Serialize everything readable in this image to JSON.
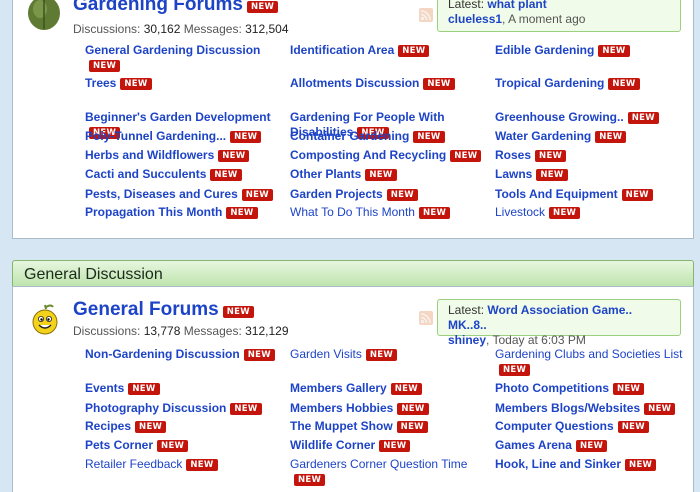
{
  "top_section": {
    "forum_title": "Gardening Forums",
    "new_badge": "NEW",
    "discussions_label": "Discussions:",
    "discussions_count": "30,162",
    "messages_label": "Messages:",
    "messages_count": "312,504",
    "latest_label": "Latest:",
    "latest_thread": "what plant",
    "latest_user": "clueless1",
    "latest_time": "A moment ago",
    "subforums": [
      {
        "label": "General Gardening Discussion",
        "bold": true
      },
      {
        "label": "Identification Area",
        "bold": true
      },
      {
        "label": "Edible Gardening",
        "bold": true
      },
      {
        "label": "Trees",
        "bold": true
      },
      {
        "label": "Allotments Discussion",
        "bold": true
      },
      {
        "label": "Tropical Gardening",
        "bold": true
      },
      {
        "label": "Beginner's Garden Development",
        "bold": true
      },
      {
        "label": "Gardening For People With Disabilities",
        "bold": true
      },
      {
        "label": "Greenhouse Growing..",
        "bold": true
      },
      {
        "label": "Poly-Tunnel Gardening...",
        "bold": true
      },
      {
        "label": "Container Gardening",
        "bold": true
      },
      {
        "label": "Water Gardening",
        "bold": true
      },
      {
        "label": "Herbs and Wildflowers",
        "bold": true
      },
      {
        "label": "Composting And Recycling",
        "bold": true
      },
      {
        "label": "Roses",
        "bold": true
      },
      {
        "label": "Cacti and Succulents",
        "bold": true
      },
      {
        "label": "Other Plants",
        "bold": true
      },
      {
        "label": "Lawns",
        "bold": true
      },
      {
        "label": "Pests, Diseases and Cures",
        "bold": true
      },
      {
        "label": "Garden Projects",
        "bold": true
      },
      {
        "label": "Tools And Equipment",
        "bold": true
      },
      {
        "label": "Propagation This Month",
        "bold": true
      },
      {
        "label": "What To Do This Month",
        "bold": false
      },
      {
        "label": "Livestock",
        "bold": false
      }
    ]
  },
  "general_section": {
    "header": "General Discussion",
    "forum_title": "General Forums",
    "new_badge": "NEW",
    "discussions_label": "Discussions:",
    "discussions_count": "13,778",
    "messages_label": "Messages:",
    "messages_count": "312,129",
    "latest_label": "Latest:",
    "latest_thread": "Word Association Game.. MK..8..",
    "latest_user": "shiney",
    "latest_time": "Today at 6:03 PM",
    "subforums": [
      {
        "label": "Non-Gardening Discussion",
        "bold": true
      },
      {
        "label": "Garden Visits",
        "bold": false
      },
      {
        "label": "Gardening Clubs and Societies List",
        "bold": false
      },
      {
        "label": "Events",
        "bold": true
      },
      {
        "label": "Members Gallery",
        "bold": true
      },
      {
        "label": "Photo Competitions",
        "bold": true
      },
      {
        "label": "Photography Discussion",
        "bold": true
      },
      {
        "label": "Members Hobbies",
        "bold": true
      },
      {
        "label": "Members Blogs/Websites",
        "bold": true
      },
      {
        "label": "Recipes",
        "bold": true
      },
      {
        "label": "The Muppet Show",
        "bold": true
      },
      {
        "label": "Computer Questions",
        "bold": true
      },
      {
        "label": "Pets Corner",
        "bold": true
      },
      {
        "label": "Wildlife Corner",
        "bold": true
      },
      {
        "label": "Games Arena",
        "bold": true
      },
      {
        "label": "Retailer Feedback",
        "bold": false
      },
      {
        "label": "Gardeners Corner Question Time",
        "bold": false
      },
      {
        "label": "Hook, Line and Sinker",
        "bold": true
      }
    ]
  },
  "colors": {
    "link": "#1d44c6",
    "badge": "#c3150c",
    "header_green": "#bfe4ad",
    "page_bg": "#d6e6f3"
  },
  "icons": {
    "top_forum": "leaf-icon",
    "general_forum": "smiley-icon",
    "rss": "rss-feed-icon"
  }
}
